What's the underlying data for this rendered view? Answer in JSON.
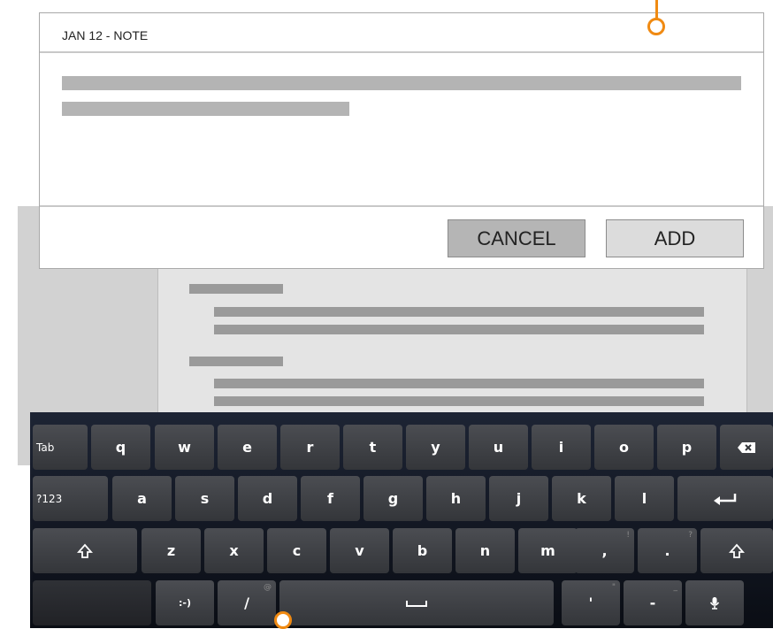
{
  "dialog": {
    "title": "JAN 12 - NOTE",
    "cancel_label": "CANCEL",
    "add_label": "ADD"
  },
  "colors": {
    "accent": "#f08a12",
    "keyboard_bg": "#141924"
  },
  "keyboard": {
    "row1": [
      "Tab",
      "q",
      "w",
      "e",
      "r",
      "t",
      "y",
      "u",
      "i",
      "o",
      "p"
    ],
    "row2": [
      "?123",
      "a",
      "s",
      "d",
      "f",
      "g",
      "h",
      "j",
      "k",
      "l"
    ],
    "row3": [
      "z",
      "x",
      "c",
      "v",
      "b",
      "n",
      "m",
      ",",
      "."
    ],
    "row3_sup": [
      "!",
      "?"
    ],
    "row4": [
      ":-)",
      "/",
      "'",
      "-"
    ],
    "row4_sup": [
      "@",
      "\"",
      "_"
    ],
    "icons": {
      "backspace": "backspace-icon",
      "enter": "enter-icon",
      "shift": "shift-icon",
      "space": "space-icon",
      "mic": "microphone-icon"
    }
  }
}
